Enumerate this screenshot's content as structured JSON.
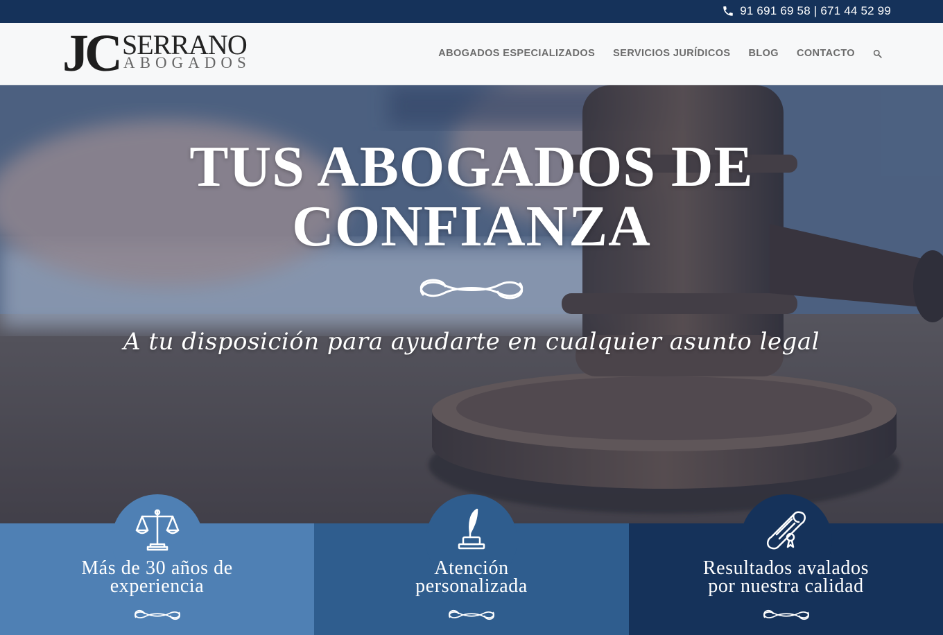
{
  "topbar": {
    "phones": "91 691 69 58 | 671 44 52 99"
  },
  "logo": {
    "initials": "JC",
    "name": "SERRANO",
    "tagline": "ABOGADOS"
  },
  "nav": {
    "items": [
      {
        "label": "ABOGADOS ESPECIALIZADOS"
      },
      {
        "label": "SERVICIOS JURÍDICOS"
      },
      {
        "label": "BLOG"
      },
      {
        "label": "CONTACTO"
      }
    ],
    "search_icon": "search-icon"
  },
  "hero": {
    "title_line1": "TUS ABOGADOS DE",
    "title_line2": "CONFIANZA",
    "subtitle": "A tu disposición para ayudarte en cualquier asunto legal"
  },
  "features": [
    {
      "line1": "Más de 30 años de",
      "line2": "experiencia",
      "icon": "scales-icon",
      "color": "#4f80b4"
    },
    {
      "line1": "Atención",
      "line2": "personalizada",
      "icon": "quill-inkwell-icon",
      "color": "#2f5d8e"
    },
    {
      "line1": "Resultados avalados",
      "line2": "por nuestra calidad",
      "icon": "diploma-scroll-icon",
      "color": "#15325a"
    }
  ],
  "colors": {
    "topbar": "#15325a",
    "header_bg": "#f7f8f9",
    "nav_text": "#6b6b6b",
    "feature_light": "#4f80b4",
    "feature_mid": "#2f5d8e",
    "feature_dark": "#15325a"
  }
}
